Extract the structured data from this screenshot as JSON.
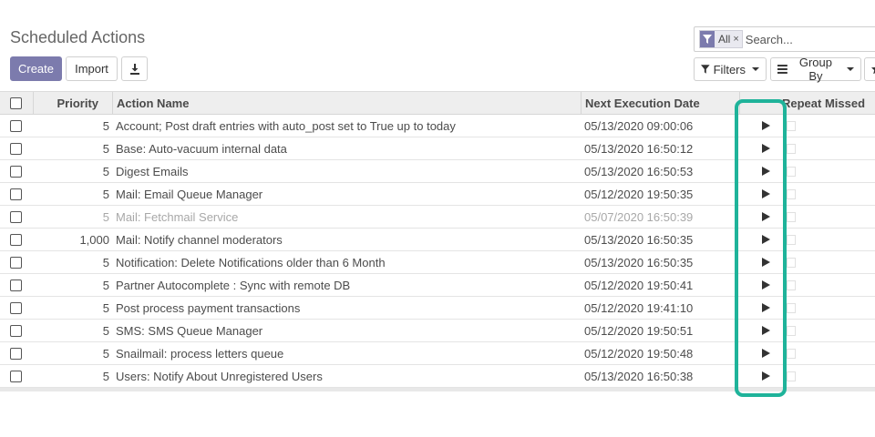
{
  "page": {
    "title": "Scheduled Actions"
  },
  "toolbar": {
    "create_label": "Create",
    "import_label": "Import",
    "download_icon": "download-icon"
  },
  "search": {
    "facet_icon": "filter-icon",
    "facet_label": "All",
    "facet_close": "×",
    "placeholder": "Search..."
  },
  "search_options": {
    "filters_label": "Filters",
    "group_by_label": "Group By",
    "favorites_icon": "star-icon"
  },
  "table": {
    "columns": {
      "priority": "Priority",
      "action_name": "Action Name",
      "next_execution": "Next Execution Date",
      "repeat_missed": "Repeat Missed"
    },
    "rows": [
      {
        "priority": "5",
        "name": "Account; Post draft entries with auto_post set to True up to today",
        "next": "05/13/2020 09:00:06",
        "active": true
      },
      {
        "priority": "5",
        "name": "Base: Auto-vacuum internal data",
        "next": "05/13/2020 16:50:12",
        "active": true
      },
      {
        "priority": "5",
        "name": "Digest Emails",
        "next": "05/13/2020 16:50:53",
        "active": true
      },
      {
        "priority": "5",
        "name": "Mail: Email Queue Manager",
        "next": "05/12/2020 19:50:35",
        "active": true
      },
      {
        "priority": "5",
        "name": "Mail: Fetchmail Service",
        "next": "05/07/2020 16:50:39",
        "active": false
      },
      {
        "priority": "1,000",
        "name": "Mail: Notify channel moderators",
        "next": "05/13/2020 16:50:35",
        "active": true
      },
      {
        "priority": "5",
        "name": "Notification: Delete Notifications older than 6 Month",
        "next": "05/13/2020 16:50:35",
        "active": true
      },
      {
        "priority": "5",
        "name": "Partner Autocomplete : Sync with remote DB",
        "next": "05/12/2020 19:50:41",
        "active": true
      },
      {
        "priority": "5",
        "name": "Post process payment transactions",
        "next": "05/12/2020 19:41:10",
        "active": true
      },
      {
        "priority": "5",
        "name": "SMS: SMS Queue Manager",
        "next": "05/12/2020 19:50:51",
        "active": true
      },
      {
        "priority": "5",
        "name": "Snailmail: process letters queue",
        "next": "05/12/2020 19:50:48",
        "active": true
      },
      {
        "priority": "5",
        "name": "Users: Notify About Unregistered Users",
        "next": "05/13/2020 16:50:38",
        "active": true
      }
    ]
  },
  "colors": {
    "primary": "#7c7bad",
    "highlight": "#1fb39a",
    "header_bg": "#eeeeee",
    "inactive_text": "#a8a8a8"
  }
}
